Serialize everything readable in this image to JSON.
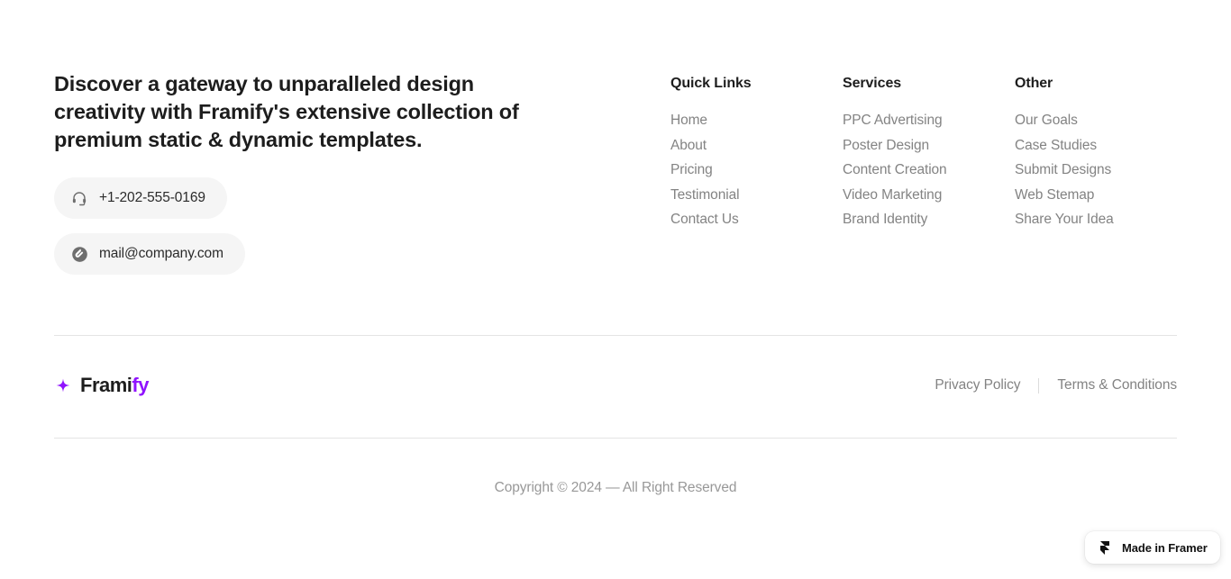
{
  "brand": {
    "tagline": "Discover a gateway to unparalleled design creativity with Framify's extensive collection of premium static & dynamic templates.",
    "logo_name_primary": "Frami",
    "logo_name_accent": "fy",
    "accent_color": "#9013fe"
  },
  "contacts": [
    {
      "icon": "headset-icon",
      "label": "+1-202-555-0169"
    },
    {
      "icon": "paperclip-circle-icon",
      "label": "mail@company.com"
    }
  ],
  "columns": [
    {
      "title": "Quick Links",
      "links": [
        "Home",
        "About",
        "Pricing",
        "Testimonial",
        "Contact Us"
      ]
    },
    {
      "title": "Services",
      "links": [
        "PPC Advertising",
        "Poster Design",
        "Content Creation",
        "Video Marketing",
        "Brand Identity"
      ]
    },
    {
      "title": "Other",
      "links": [
        "Our Goals",
        "Case Studies",
        "Submit Designs",
        "Web Stemap",
        "Share Your Idea"
      ]
    }
  ],
  "legal": {
    "privacy": "Privacy Policy",
    "terms": "Terms & Conditions"
  },
  "copyright": "Copyright © 2024 — All Right Reserved",
  "badge": {
    "label": "Made in Framer",
    "icon": "framer-logo-icon"
  }
}
